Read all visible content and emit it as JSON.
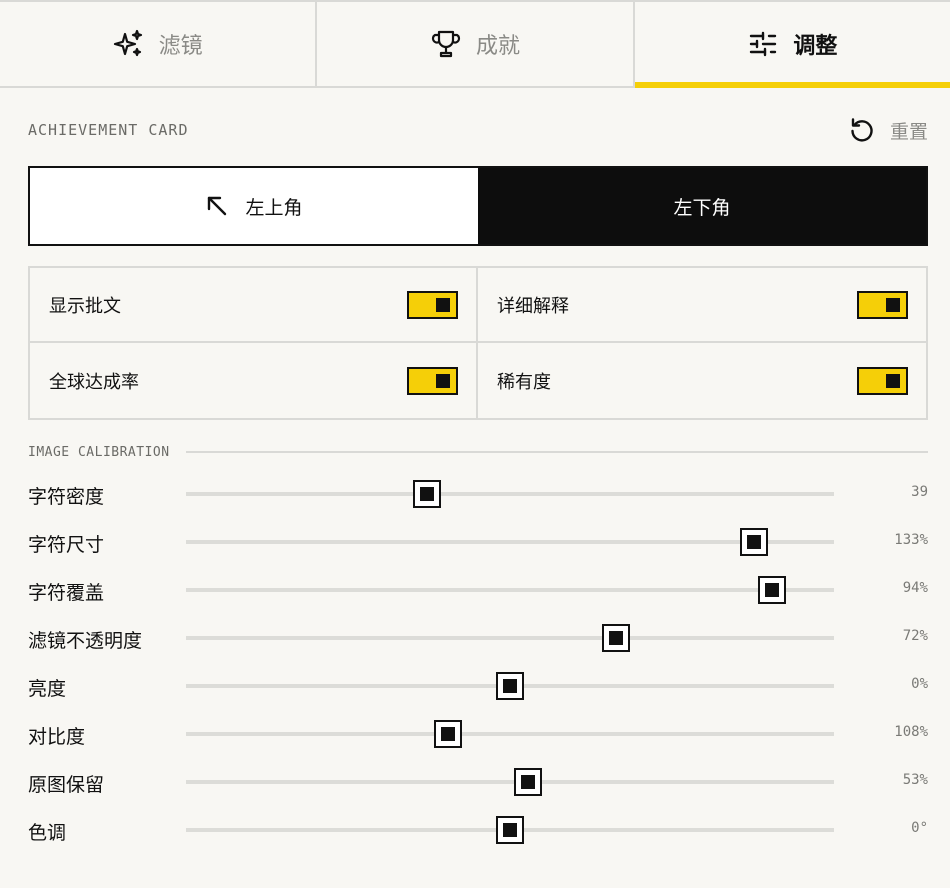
{
  "tabs": [
    {
      "label": "滤镜",
      "icon": "sparkles-icon",
      "active": false
    },
    {
      "label": "成就",
      "icon": "trophy-icon",
      "active": false
    },
    {
      "label": "调整",
      "icon": "sliders-icon",
      "active": true
    }
  ],
  "section": {
    "title": "ACHIEVEMENT CARD",
    "reset_label": "重置"
  },
  "corner": {
    "options": [
      {
        "label": "左上角",
        "icon": "arrow-up-left-icon",
        "selected": false
      },
      {
        "label": "左下角",
        "selected": true
      }
    ]
  },
  "toggles": [
    {
      "label": "显示批文",
      "on": true
    },
    {
      "label": "详细解释",
      "on": true
    },
    {
      "label": "全球达成率",
      "on": true
    },
    {
      "label": "稀有度",
      "on": true
    }
  ],
  "calibration": {
    "title": "IMAGE CALIBRATION",
    "sliders": [
      {
        "label": "字符密度",
        "value_text": "39",
        "fraction": 0.372
      },
      {
        "label": "字符尺寸",
        "value_text": "133%",
        "fraction": 0.876
      },
      {
        "label": "字符覆盖",
        "value_text": "94%",
        "fraction": 0.904
      },
      {
        "label": "滤镜不透明度",
        "value_text": "72%",
        "fraction": 0.664
      },
      {
        "label": "亮度",
        "value_text": "0%",
        "fraction": 0.5
      },
      {
        "label": "对比度",
        "value_text": "108%",
        "fraction": 0.404
      },
      {
        "label": "原图保留",
        "value_text": "53%",
        "fraction": 0.528
      },
      {
        "label": "色调",
        "value_text": "0°",
        "fraction": 0.5
      }
    ]
  },
  "colors": {
    "accent": "#f5cf08",
    "dark": "#0d0d0d",
    "background": "#f8f7f3",
    "border": "#d9d9d6"
  }
}
